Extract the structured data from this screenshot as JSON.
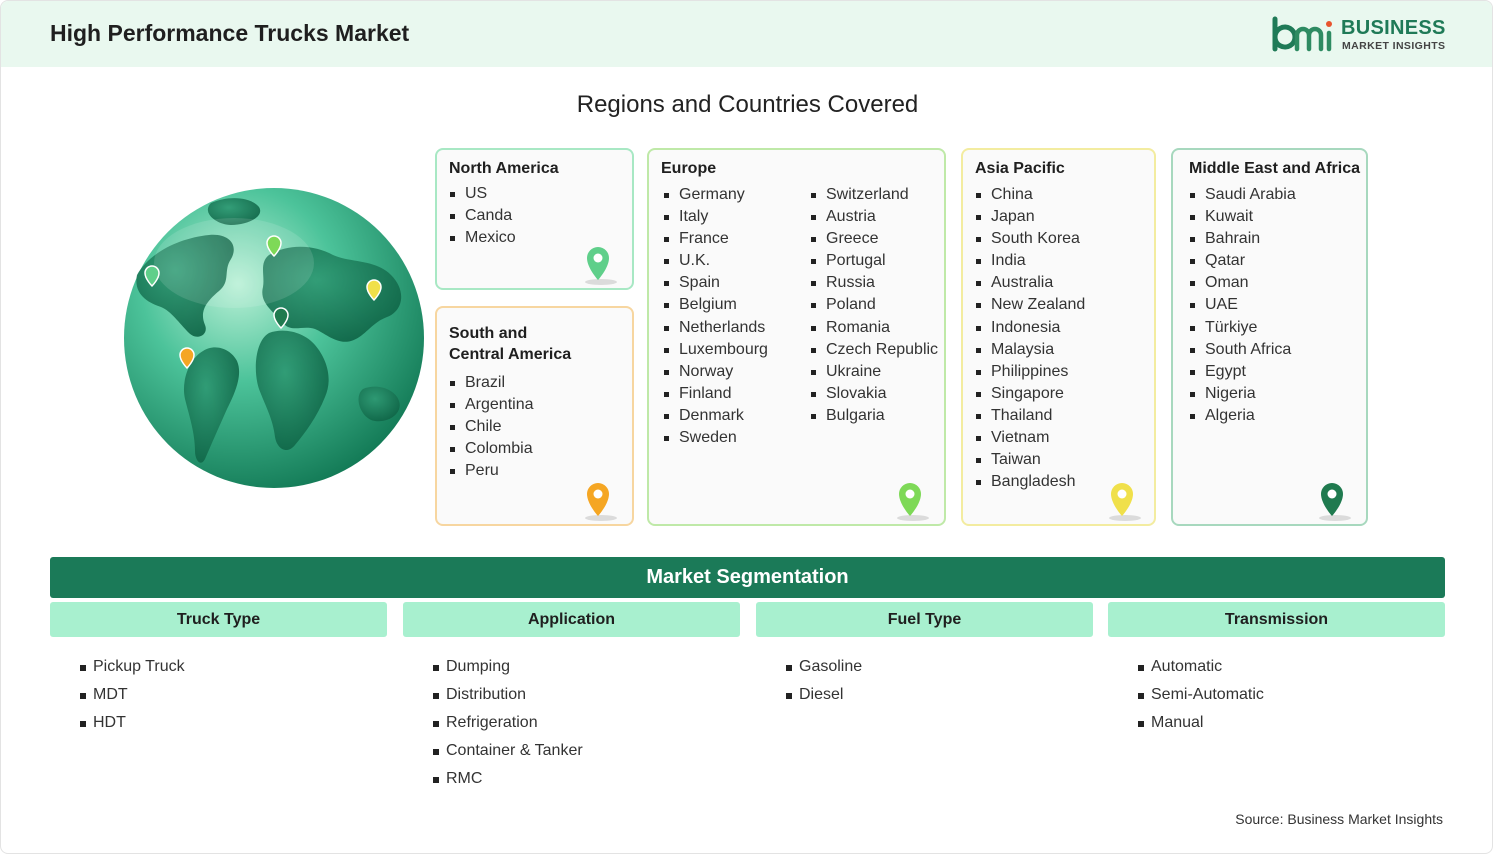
{
  "header": {
    "title": "High Performance Trucks Market",
    "logo_line1": "BUSINESS",
    "logo_line2": "MARKET INSIGHTS"
  },
  "regions_title": "Regions and Countries Covered",
  "regions": {
    "north_america": {
      "title": "North America",
      "items": [
        "US",
        "Canda",
        "Mexico"
      ],
      "color": "#5fcf8a"
    },
    "south_central_america": {
      "title": "South and\nCentral America",
      "items": [
        "Brazil",
        "Argentina",
        "Chile",
        "Colombia",
        "Peru"
      ],
      "color": "#f5a623"
    },
    "europe": {
      "title": "Europe",
      "col1": [
        "Germany",
        "Italy",
        "France",
        "U.K.",
        "Spain",
        "Belgium",
        "Netherlands",
        "Luxembourg",
        "Norway",
        "Finland",
        "Denmark",
        "Sweden"
      ],
      "col2": [
        "Switzerland",
        "Austria",
        "Greece",
        "Portugal",
        "Russia",
        "Poland",
        "Romania",
        "Czech Republic",
        "Ukraine",
        "Slovakia",
        "Bulgaria"
      ],
      "color": "#7ed957"
    },
    "asia_pacific": {
      "title": "Asia Pacific",
      "items": [
        "China",
        "Japan",
        "South Korea",
        "India",
        "Australia",
        "New Zealand",
        "Indonesia",
        "Malaysia",
        "Philippines",
        "Singapore",
        "Thailand",
        "Vietnam",
        "Taiwan",
        "Bangladesh"
      ],
      "color": "#f0e04a"
    },
    "middle_east_africa": {
      "title": "Middle East and Africa",
      "items": [
        "Saudi Arabia",
        "Kuwait",
        "Bahrain",
        "Qatar",
        "Oman",
        "UAE",
        "Türkiye",
        "South Africa",
        "Egypt",
        "Nigeria",
        "Algeria"
      ],
      "color": "#1f7a4f"
    }
  },
  "segmentation": {
    "title": "Market Segmentation",
    "columns": [
      {
        "head": "Truck Type",
        "items": [
          "Pickup Truck",
          "MDT",
          "HDT"
        ]
      },
      {
        "head": "Application",
        "items": [
          "Dumping",
          "Distribution",
          "Refrigeration",
          "Container & Tanker",
          "RMC"
        ]
      },
      {
        "head": "Fuel Type",
        "items": [
          "Gasoline",
          "Diesel"
        ]
      },
      {
        "head": "Transmission",
        "items": [
          "Automatic",
          "Semi-Automatic",
          "Manual"
        ]
      }
    ]
  },
  "source": "Source: Business Market Insights",
  "colors": {
    "accent": "#1b7a58",
    "header_bg": "#e9f8ef",
    "seg_head_bg": "#a8f0cf"
  }
}
